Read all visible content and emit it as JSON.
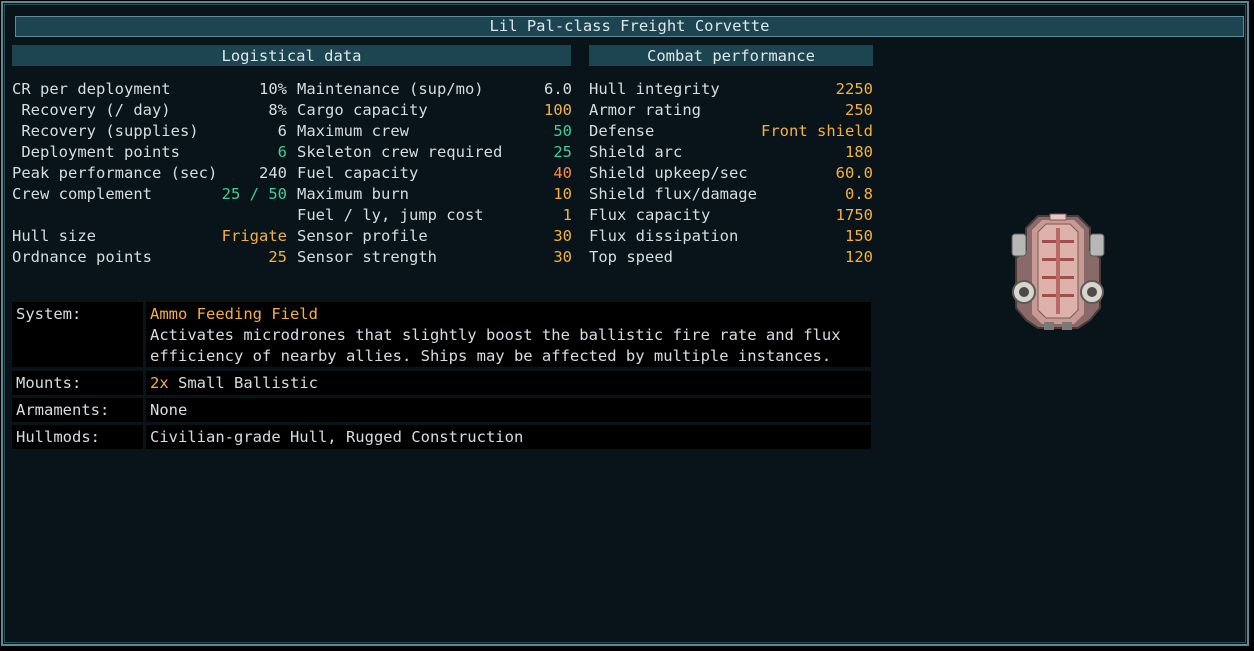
{
  "title": "Lil Pal-class Freight Corvette",
  "headers": {
    "logistical": "Logistical data",
    "combat": "Combat performance"
  },
  "colors": {
    "frame": "#5b8a97",
    "header": "#1d4551",
    "yellow": "#f5b23b",
    "green": "#3fcf9b",
    "orange": "#ff8a3a",
    "text": "#d6dde2"
  },
  "col1": [
    {
      "label": "CR per deployment",
      "value": "10%",
      "color": "white"
    },
    {
      "label": " Recovery (/ day)",
      "value": "8%",
      "color": "white"
    },
    {
      "label": " Recovery (supplies)",
      "value": "6",
      "color": "white"
    },
    {
      "label": " Deployment points",
      "value": "6",
      "color": "green"
    },
    {
      "label": "Peak performance (sec)",
      "value": "240",
      "color": "white"
    },
    {
      "label": "Crew complement",
      "value": "25 / 50",
      "color": "green"
    },
    {
      "label": "",
      "value": "",
      "color": "white"
    },
    {
      "label": "Hull size",
      "value": "Frigate",
      "color": "yellow"
    },
    {
      "label": "Ordnance points",
      "value": "25",
      "color": "yellow"
    }
  ],
  "col2": [
    {
      "label": "Maintenance (sup/mo)",
      "value": "6.0",
      "color": "white"
    },
    {
      "label": "Cargo capacity",
      "value": "100",
      "color": "yellow"
    },
    {
      "label": "Maximum crew",
      "value": "50",
      "color": "green"
    },
    {
      "label": "Skeleton crew required",
      "value": "25",
      "color": "green"
    },
    {
      "label": "Fuel capacity",
      "value": "40",
      "color": "orange"
    },
    {
      "label": "Maximum burn",
      "value": "10",
      "color": "yellow"
    },
    {
      "label": "Fuel / ly, jump cost",
      "value": "1",
      "color": "yellow"
    },
    {
      "label": "Sensor profile",
      "value": "30",
      "color": "yellow"
    },
    {
      "label": "Sensor strength",
      "value": "30",
      "color": "yellow"
    }
  ],
  "col3": [
    {
      "label": "Hull integrity",
      "value": "2250",
      "color": "yellow"
    },
    {
      "label": "Armor rating",
      "value": "250",
      "color": "yellow"
    },
    {
      "label": "Defense",
      "value": "Front shield",
      "color": "yellow"
    },
    {
      "label": "Shield arc",
      "value": "180",
      "color": "yellow"
    },
    {
      "label": "Shield upkeep/sec",
      "value": "60.0",
      "color": "yellow"
    },
    {
      "label": "Shield flux/damage",
      "value": "0.8",
      "color": "yellow"
    },
    {
      "label": "Flux capacity",
      "value": "1750",
      "color": "yellow"
    },
    {
      "label": "Flux dissipation",
      "value": "150",
      "color": "yellow"
    },
    {
      "label": "Top speed",
      "value": "120",
      "color": "yellow"
    }
  ],
  "system": {
    "label": "System:",
    "name": "Ammo Feeding Field",
    "desc1": "Activates microdrones that slightly boost the ballistic fire rate and flux",
    "desc2": "efficiency of nearby allies. Ships may be affected by multiple instances."
  },
  "mounts": {
    "label": "Mounts:",
    "count": "2x",
    "type": " Small Ballistic"
  },
  "armaments": {
    "label": "Armaments:",
    "value": "None"
  },
  "hullmods": {
    "label": "Hullmods:",
    "value": "Civilian-grade Hull, Rugged Construction"
  }
}
